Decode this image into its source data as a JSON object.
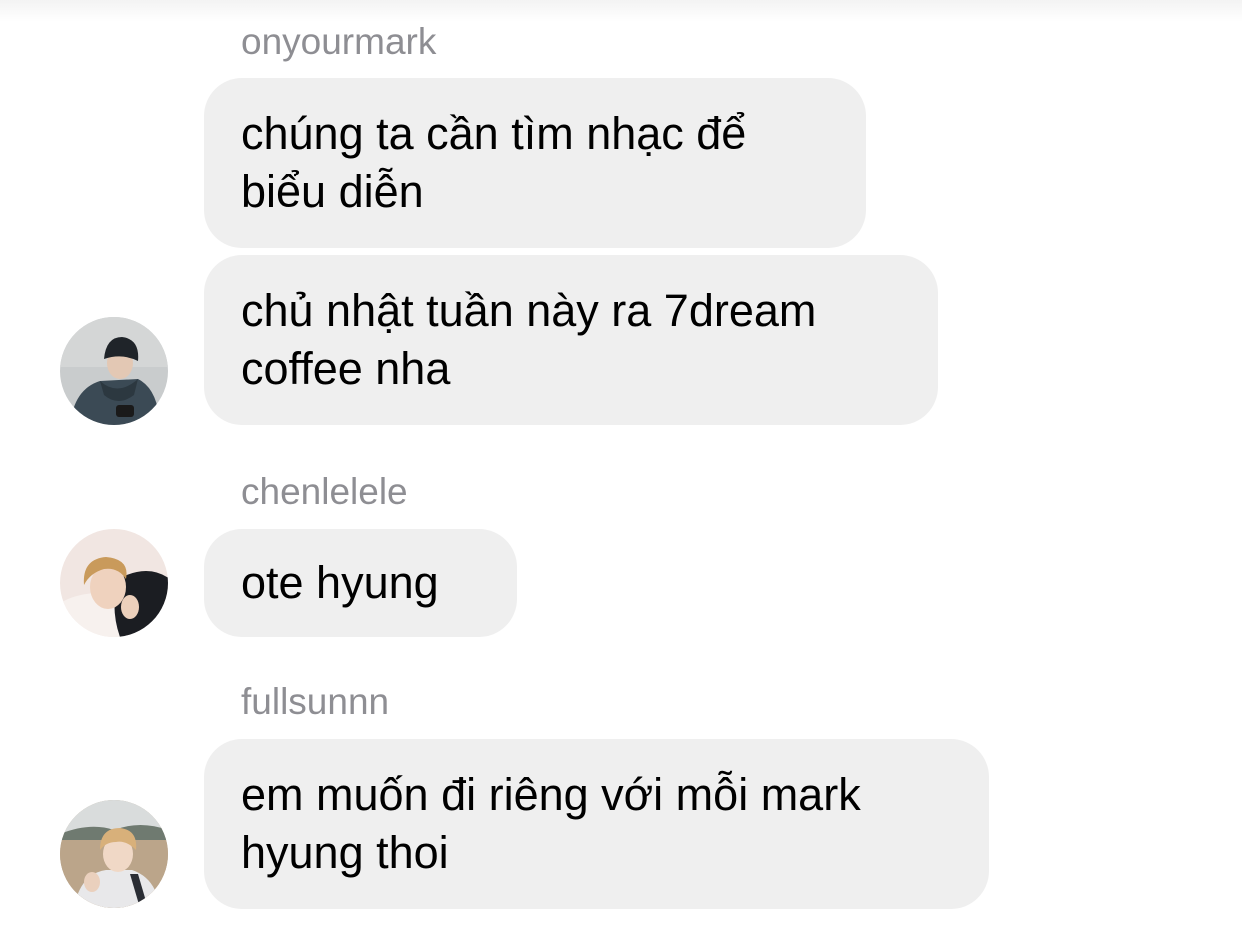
{
  "messages": [
    {
      "sender": "onyourmark",
      "bubbles": [
        "chúng ta cần tìm nhạc để\nbiểu diễn",
        "chủ nhật tuần này ra 7dream\ncoffee nha"
      ],
      "avatar": "profile-photo-onyourmark"
    },
    {
      "sender": "chenlelele",
      "bubbles": [
        "ote hyung"
      ],
      "avatar": "profile-photo-chenlelele"
    },
    {
      "sender": "fullsunnn",
      "bubbles": [
        "em muốn đi riêng với mỗi mark\nhyung thoi"
      ],
      "avatar": "profile-photo-fullsunnn"
    }
  ],
  "colors": {
    "bubble_bg": "#efefef",
    "sender_text": "#8e8e93",
    "message_text": "#000000"
  }
}
